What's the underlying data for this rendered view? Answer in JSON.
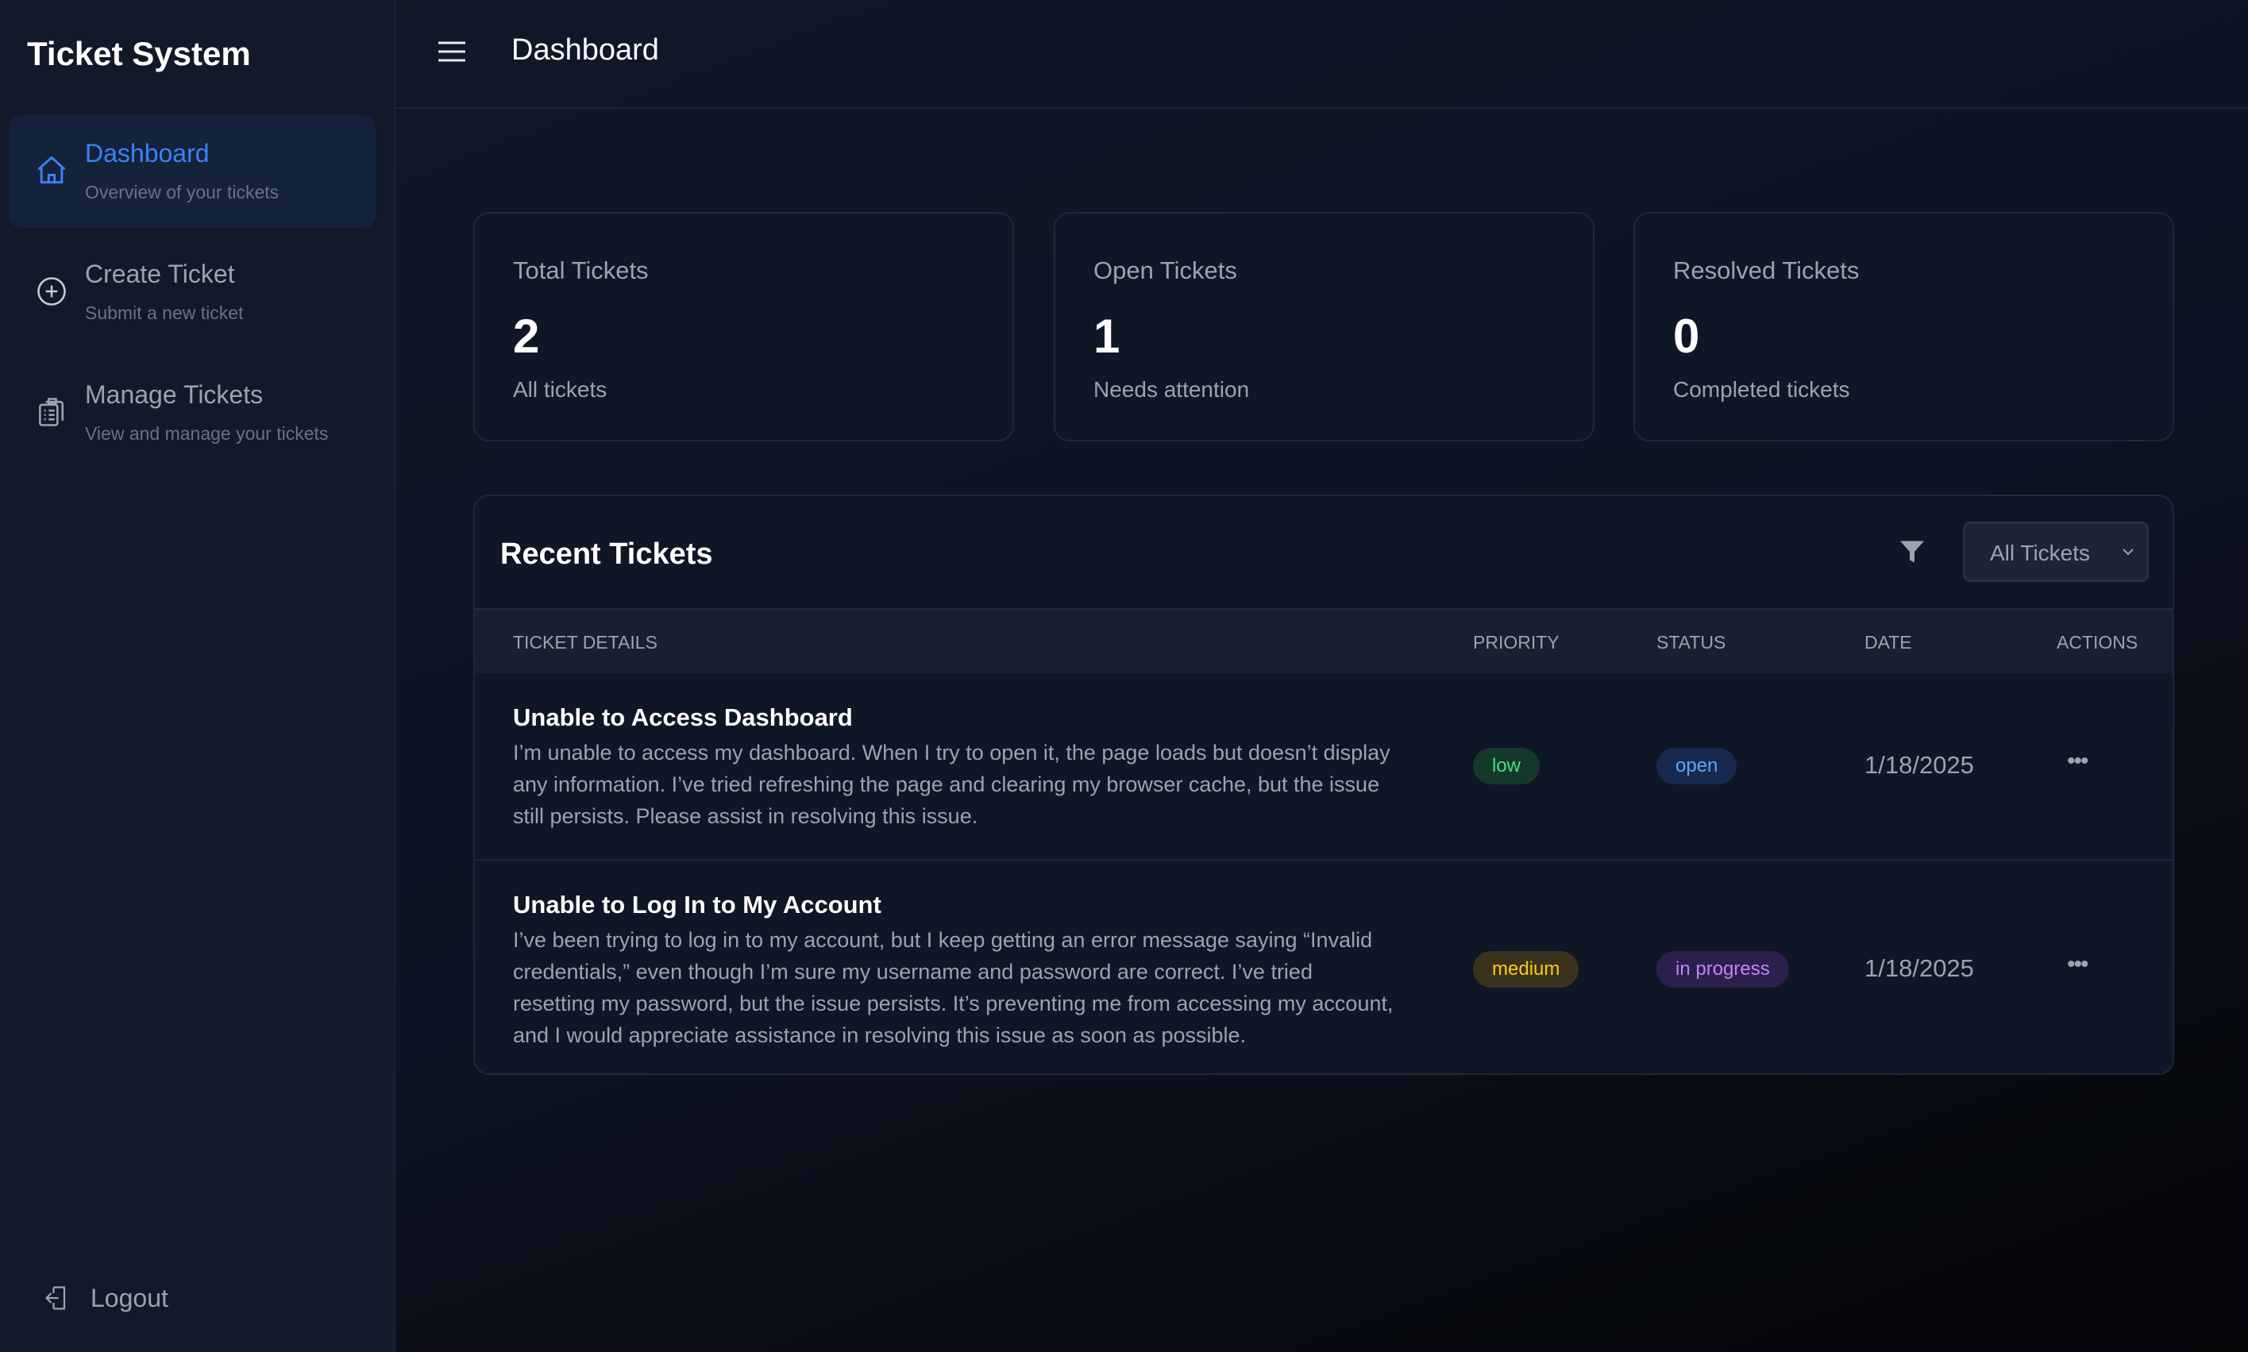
{
  "sidebar": {
    "brand": "Ticket System",
    "items": [
      {
        "label": "Dashboard",
        "sub": "Overview of your tickets",
        "icon": "home-icon"
      },
      {
        "label": "Create Ticket",
        "sub": "Submit a new ticket",
        "icon": "plus-circle-icon"
      },
      {
        "label": "Manage Tickets",
        "sub": "View and manage your tickets",
        "icon": "clipboard-icon"
      }
    ],
    "logout": "Logout"
  },
  "header": {
    "title": "Dashboard"
  },
  "stats": [
    {
      "title": "Total Tickets",
      "value": "2",
      "sub": "All tickets"
    },
    {
      "title": "Open Tickets",
      "value": "1",
      "sub": "Needs attention"
    },
    {
      "title": "Resolved Tickets",
      "value": "0",
      "sub": "Completed tickets"
    }
  ],
  "recent": {
    "title": "Recent Tickets",
    "filter": "All Tickets",
    "columns": [
      "TICKET DETAILS",
      "PRIORITY",
      "STATUS",
      "DATE",
      "ACTIONS"
    ],
    "rows": [
      {
        "title": "Unable to Access Dashboard",
        "desc": "I’m unable to access my dashboard. When I try to open it, the page loads but doesn’t display any information. I’ve tried refreshing the page and clearing my browser cache, but the issue still persists. Please assist in resolving this issue.",
        "priority": "low",
        "status": "open",
        "date": "1/18/2025",
        "actions": "•••"
      },
      {
        "title": "Unable to Log In to My Account",
        "desc": "I’ve been trying to log in to my account, but I keep getting an error message saying “Invalid credentials,” even though I’m sure my username and password are correct. I’ve tried resetting my password, but the issue persists. It’s preventing me from accessing my account, and I would appreciate assistance in resolving this issue as soon as possible.",
        "priority": "medium",
        "status": "in progress",
        "date": "1/18/2025",
        "actions": "•••"
      }
    ]
  },
  "colors": {
    "accent": "#3b82f6",
    "low": "#4ade80",
    "open": "#60a5fa",
    "medium": "#facc15",
    "in_progress": "#c084fc"
  }
}
